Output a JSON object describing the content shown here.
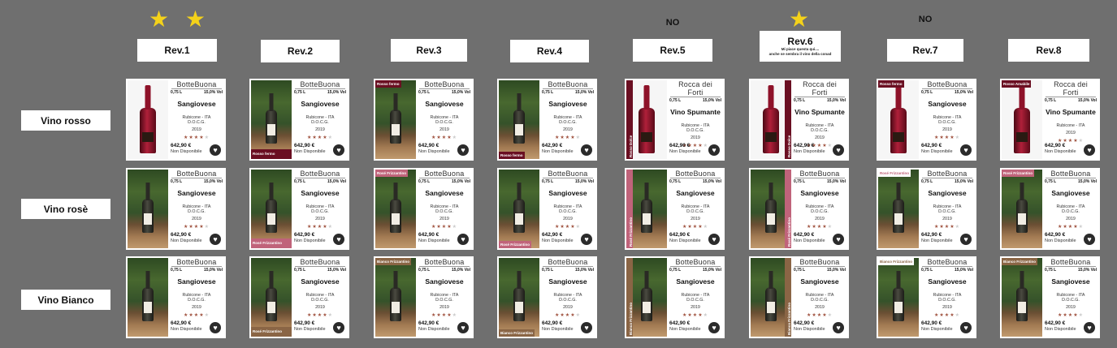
{
  "revisions": [
    {
      "title": "Rev.1",
      "mark": "★ ★",
      "mark_type": "stars",
      "note": ""
    },
    {
      "title": "Rev.2",
      "mark": "",
      "mark_type": "",
      "note": ""
    },
    {
      "title": "Rev.3",
      "mark": "",
      "mark_type": "",
      "note": ""
    },
    {
      "title": "Rev.4",
      "mark": "",
      "mark_type": "",
      "note": ""
    },
    {
      "title": "Rev.5",
      "mark": "NO",
      "mark_type": "text",
      "note": ""
    },
    {
      "title": "Rev.6",
      "mark": "★",
      "mark_type": "stars",
      "note": "Mi piace questa qui....\nanche se sembra il vino della conad"
    },
    {
      "title": "Rev.7",
      "mark": "NO",
      "mark_type": "text",
      "note": ""
    },
    {
      "title": "Rev.8",
      "mark": "",
      "mark_type": "",
      "note": ""
    }
  ],
  "rows": [
    "Vino rosso",
    "Vino rosè",
    "Vino Bianco"
  ],
  "colors": {
    "wine_red": "#6a0f22",
    "rose_pink": "#c0637a",
    "white_brown": "#8a6545",
    "background": "#6f6f6f",
    "star_yellow": "#f4d21a",
    "rating_star": "#a0523f"
  },
  "cards": [
    [
      {
        "brand": "BotteBuona",
        "name": "Sangiovese",
        "tag": "",
        "tag_style": "",
        "image": "red-bottle"
      },
      {
        "brand": "BotteBuona",
        "name": "Sangiovese",
        "tag": "Rosso fermo",
        "tag_style": "bottom-bar",
        "image": "garden"
      },
      {
        "brand": "BotteBuona",
        "name": "Sangiovese",
        "tag": "Rosso fermo",
        "tag_style": "top-tag",
        "image": "garden"
      },
      {
        "brand": "BotteBuona",
        "name": "Sangiovese",
        "tag": "Rosso fermo",
        "tag_style": "bottom-tag",
        "image": "garden"
      },
      {
        "brand": "Rocca dei Forti",
        "name": "Vino Spumante",
        "tag": "Rosso Dolce",
        "tag_style": "strip",
        "image": "red-bottle"
      },
      {
        "brand": "Rocca dei Forti",
        "name": "Vino Spumante",
        "tag": "Rosso Dolce",
        "tag_style": "strip-right",
        "image": "red-bottle"
      },
      {
        "brand": "BotteBuona",
        "name": "Sangiovese",
        "tag": "Rosso fermo",
        "tag_style": "top-tag",
        "image": "red-bottle"
      },
      {
        "brand": "Rocca dei Forti",
        "name": "Vino Spumante",
        "tag": "Rosso Amabile",
        "tag_style": "top-tag",
        "image": "red-bottle"
      }
    ],
    [
      {
        "brand": "BotteBuona",
        "name": "Sangiovese",
        "tag": "",
        "tag_style": "",
        "image": "garden"
      },
      {
        "brand": "BotteBuona",
        "name": "Sangiovese",
        "tag": "Rosé Frizzantino",
        "tag_style": "bottom-bar",
        "image": "garden"
      },
      {
        "brand": "BotteBuona",
        "name": "Sangiovese",
        "tag": "Rosé Frizzantino",
        "tag_style": "top-tag",
        "image": "garden"
      },
      {
        "brand": "BotteBuona",
        "name": "Sangiovese",
        "tag": "Rosé Frizzantino",
        "tag_style": "bottom-tag",
        "image": "garden"
      },
      {
        "brand": "BotteBuona",
        "name": "Sangiovese",
        "tag": "Rosé Frizzantino",
        "tag_style": "strip",
        "image": "garden"
      },
      {
        "brand": "BotteBuona",
        "name": "Sangiovese",
        "tag": "Rosé Frizzantino",
        "tag_style": "strip-right",
        "image": "garden"
      },
      {
        "brand": "BotteBuona",
        "name": "Sangiovese",
        "tag": "Rosé Frizzantino",
        "tag_style": "top-tag-light",
        "image": "garden"
      },
      {
        "brand": "BotteBuona",
        "name": "Sangiovese",
        "tag": "Rosé Frizzantino",
        "tag_style": "top-tag",
        "image": "garden"
      }
    ],
    [
      {
        "brand": "BotteBuona",
        "name": "Sangiovese",
        "tag": "",
        "tag_style": "",
        "image": "garden"
      },
      {
        "brand": "BotteBuona",
        "name": "Sangiovese",
        "tag": "Rosé Frizzantino",
        "tag_style": "bottom-bar",
        "image": "garden"
      },
      {
        "brand": "BotteBuona",
        "name": "Sangiovese",
        "tag": "Bianco Frizzantino",
        "tag_style": "top-tag",
        "image": "garden"
      },
      {
        "brand": "BotteBuona",
        "name": "Sangiovese",
        "tag": "Bianco Frizzantino",
        "tag_style": "bottom-tag",
        "image": "garden"
      },
      {
        "brand": "BotteBuona",
        "name": "Sangiovese",
        "tag": "Bianco Frizzantino",
        "tag_style": "strip",
        "image": "garden"
      },
      {
        "brand": "BotteBuona",
        "name": "Sangiovese",
        "tag": "Bianco Frizzantino",
        "tag_style": "strip-right",
        "image": "garden"
      },
      {
        "brand": "BotteBuona",
        "name": "Sangiovese",
        "tag": "Bianco Frizzantino",
        "tag_style": "top-tag-light",
        "image": "garden"
      },
      {
        "brand": "BotteBuona",
        "name": "Sangiovese",
        "tag": "Bianco Frizzantino",
        "tag_style": "top-tag",
        "image": "garden"
      }
    ]
  ],
  "card_common": {
    "size": "0,75 L",
    "abv": "15,0% Vol",
    "origin_line1": "Rubicone - ITA",
    "origin_line2": "D.O.C.G.",
    "year": "2019",
    "rating": 4,
    "rating_max": 5,
    "price": "642,90 €",
    "availability": "Non Disponibile"
  },
  "card_overrides": {
    "0-7": {
      "size": "0,75 L",
      "abv": "15,0% Vol",
      "origin_line1": "Rubicone - ITA",
      "origin_line2": "",
      "year": "2019"
    }
  }
}
